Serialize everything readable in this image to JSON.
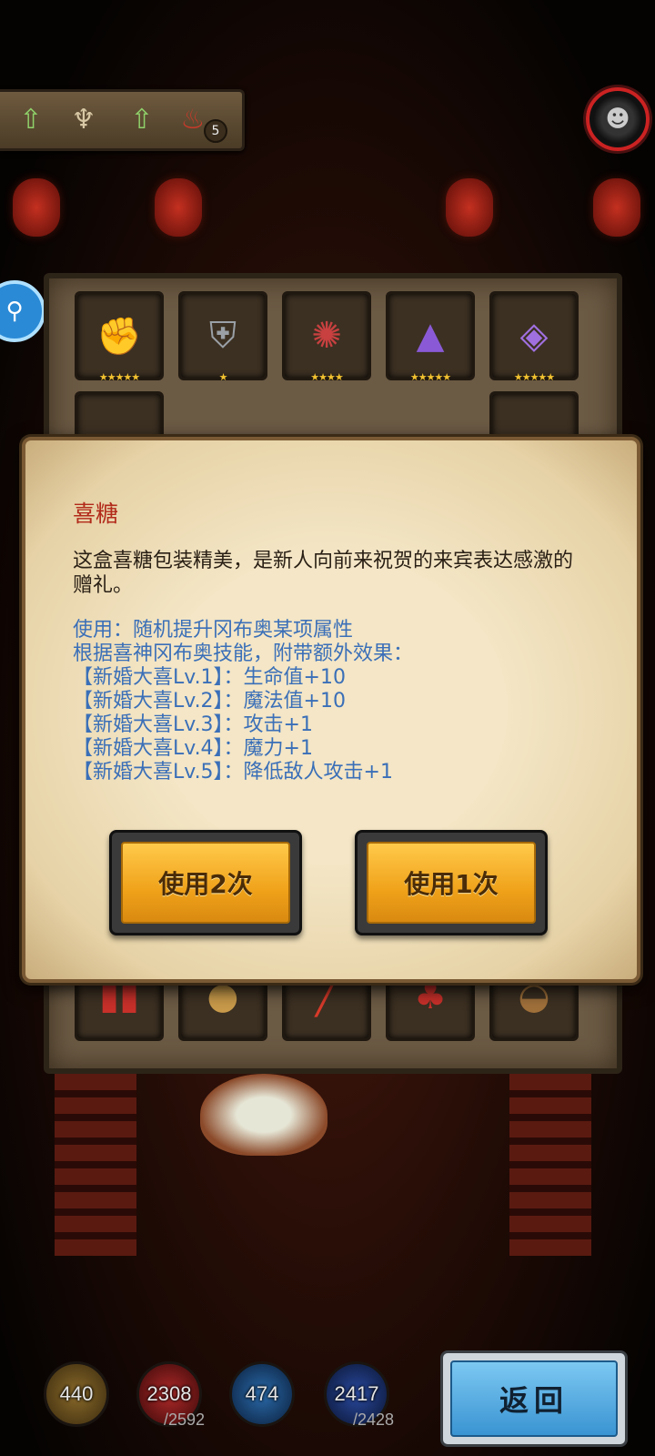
{
  "topbar": {
    "icons": [
      "up-arrow-icon",
      "candelabra-icon",
      "up-arrow-icon",
      "torch-icon"
    ],
    "torch_count": "5"
  },
  "inventory": {
    "row1": [
      {
        "icon": "gauntlet-icon",
        "stars": "★★★★★"
      },
      {
        "icon": "armor-icon",
        "stars": "★"
      },
      {
        "icon": "horn-icon",
        "stars": "★★★★"
      },
      {
        "icon": "hat-icon",
        "stars": "★★★★★"
      },
      {
        "icon": "amulet-icon",
        "stars": "★★★★★"
      }
    ],
    "row_bottom": [
      "couplet-icon",
      "nuts-icon",
      "firecracker-icon",
      "gift-bag-icon",
      "bowl-icon"
    ]
  },
  "dialog": {
    "title": "喜糖",
    "description": "这盒喜糖包装精美，是新人向前来祝贺的来宾表达感激的赠礼。",
    "usage_lines": [
      "使用：随机提升冈布奥某项属性",
      "根据喜神冈布奥技能，附带额外效果：",
      "【新婚大喜Lv.1】：生命值+10",
      "【新婚大喜Lv.2】：魔法值+10",
      "【新婚大喜Lv.3】：攻击+1",
      "【新婚大喜Lv.4】：魔力+1",
      "【新婚大喜Lv.5】：降低敌人攻击+1"
    ],
    "use_twice_label": "使用2次",
    "use_once_label": "使用1次"
  },
  "resources": {
    "gold": {
      "value": "440"
    },
    "hp": {
      "value": "2308",
      "max": "/2592"
    },
    "attack": {
      "value": "474"
    },
    "mp": {
      "value": "2417",
      "max": "/2428"
    }
  },
  "back_label": "返回",
  "colors": {
    "title_red": "#b22a1a",
    "usage_blue": "#3a6fb8",
    "button_gold": "#f0a21a",
    "back_blue": "#3a94d2"
  }
}
